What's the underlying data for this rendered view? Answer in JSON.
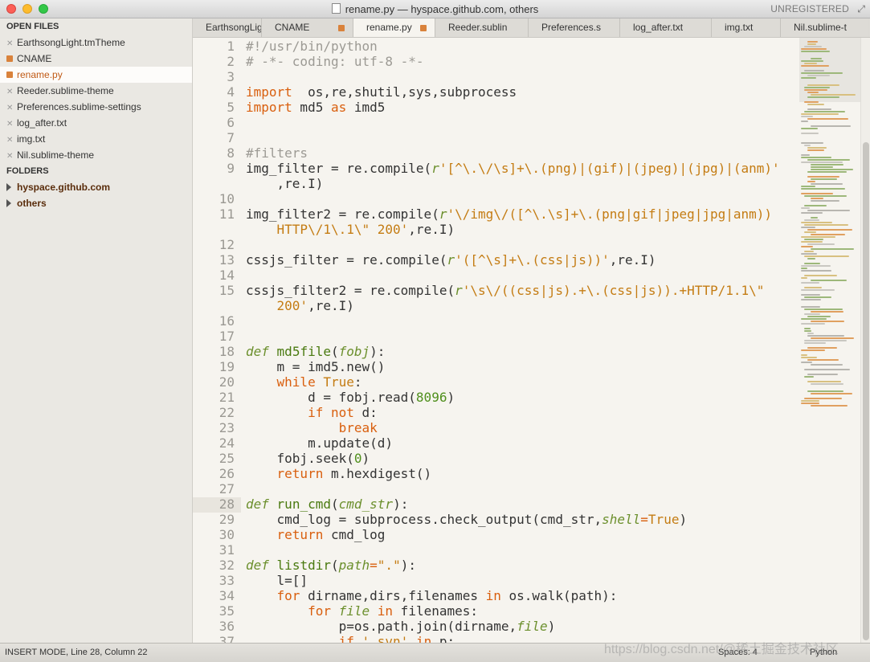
{
  "window": {
    "title": "rename.py — hyspace.github.com, others",
    "registration": "UNREGISTERED"
  },
  "sidebar": {
    "open_files_header": "OPEN FILES",
    "open_files": [
      {
        "label": "EarthsongLight.tmTheme",
        "modified": false,
        "active": false
      },
      {
        "label": "CNAME",
        "modified": true,
        "active": false
      },
      {
        "label": "rename.py",
        "modified": true,
        "active": true
      },
      {
        "label": "Reeder.sublime-theme",
        "modified": false,
        "active": false
      },
      {
        "label": "Preferences.sublime-settings",
        "modified": false,
        "active": false
      },
      {
        "label": "log_after.txt",
        "modified": false,
        "active": false
      },
      {
        "label": "img.txt",
        "modified": false,
        "active": false
      },
      {
        "label": "Nil.sublime-theme",
        "modified": false,
        "active": false
      }
    ],
    "folders_header": "FOLDERS",
    "folders": [
      {
        "label": "hyspace.github.com"
      },
      {
        "label": "others"
      }
    ]
  },
  "tabs": [
    {
      "label": "EarthsongLig",
      "modified": false,
      "active": false
    },
    {
      "label": "CNAME",
      "modified": true,
      "active": false
    },
    {
      "label": "rename.py",
      "modified": true,
      "active": true
    },
    {
      "label": "Reeder.sublin",
      "modified": false,
      "active": false
    },
    {
      "label": "Preferences.s",
      "modified": false,
      "active": false
    },
    {
      "label": "log_after.txt",
      "modified": false,
      "active": false
    },
    {
      "label": "img.txt",
      "modified": false,
      "active": false
    },
    {
      "label": "Nil.sublime-t",
      "modified": false,
      "active": false
    }
  ],
  "editor": {
    "current_line": 28,
    "lines": [
      {
        "n": "1",
        "segs": [
          [
            "cm",
            "#!/usr/bin/python"
          ]
        ]
      },
      {
        "n": "2",
        "segs": [
          [
            "cm",
            "# -*- coding: utf-8 -*-"
          ]
        ]
      },
      {
        "n": "3",
        "segs": []
      },
      {
        "n": "4",
        "segs": [
          [
            "kw",
            "import"
          ],
          [
            "",
            "  os,re,shutil,sys,subprocess"
          ]
        ]
      },
      {
        "n": "5",
        "segs": [
          [
            "kw",
            "import"
          ],
          [
            "",
            " md5 "
          ],
          [
            "kw",
            "as"
          ],
          [
            "",
            " imd5"
          ]
        ]
      },
      {
        "n": "6",
        "segs": []
      },
      {
        "n": "7",
        "segs": []
      },
      {
        "n": "8",
        "segs": [
          [
            "cm",
            "#filters"
          ]
        ]
      },
      {
        "n": "9",
        "segs": [
          [
            "",
            "img_filter = re.compile("
          ],
          [
            "it",
            "r"
          ],
          [
            "st",
            "'[^\\.\\/\\s]+\\.(png)|(gif)|(jpeg)|(jpg)|(anm)'"
          ]
        ]
      },
      {
        "n": "",
        "segs": [
          [
            "",
            "    ,re.I)"
          ]
        ]
      },
      {
        "n": "10",
        "segs": []
      },
      {
        "n": "11",
        "segs": [
          [
            "",
            "img_filter2 = re.compile("
          ],
          [
            "it",
            "r"
          ],
          [
            "st",
            "'\\/img\\/([^\\.\\s]+\\.(png|gif|jpeg|jpg|anm))"
          ]
        ]
      },
      {
        "n": "",
        "segs": [
          [
            "st",
            "    HTTP\\/1\\.1\\\" 200'"
          ],
          [
            "",
            ",re.I)"
          ]
        ]
      },
      {
        "n": "12",
        "segs": []
      },
      {
        "n": "13",
        "segs": [
          [
            "",
            "cssjs_filter = re.compile("
          ],
          [
            "it",
            "r"
          ],
          [
            "st",
            "'([^\\s]+\\.(css|js))'"
          ],
          [
            "",
            ",re.I)"
          ]
        ]
      },
      {
        "n": "14",
        "segs": []
      },
      {
        "n": "15",
        "segs": [
          [
            "",
            "cssjs_filter2 = re.compile("
          ],
          [
            "it",
            "r"
          ],
          [
            "st",
            "'\\s\\/((css|js).+\\.(css|js)).+HTTP/1.1\\\""
          ]
        ]
      },
      {
        "n": "",
        "segs": [
          [
            "st",
            "    200'"
          ],
          [
            "",
            ",re.I)"
          ]
        ]
      },
      {
        "n": "16",
        "segs": []
      },
      {
        "n": "17",
        "segs": []
      },
      {
        "n": "18",
        "segs": [
          [
            "it",
            "def"
          ],
          [
            "",
            " "
          ],
          [
            "fn",
            "md5file"
          ],
          [
            "",
            "("
          ],
          [
            "it",
            "fobj"
          ],
          [
            "",
            "):"
          ]
        ]
      },
      {
        "n": "19",
        "segs": [
          [
            "",
            "    m = imd5.new()"
          ]
        ]
      },
      {
        "n": "20",
        "segs": [
          [
            "",
            "    "
          ],
          [
            "kw",
            "while"
          ],
          [
            "",
            " "
          ],
          [
            "st",
            "True"
          ],
          [
            "",
            ":"
          ]
        ]
      },
      {
        "n": "21",
        "segs": [
          [
            "",
            "        d = fobj.read("
          ],
          [
            "nm",
            "8096"
          ],
          [
            "",
            ")"
          ]
        ]
      },
      {
        "n": "22",
        "segs": [
          [
            "",
            "        "
          ],
          [
            "kw",
            "if not"
          ],
          [
            "",
            " d:"
          ]
        ]
      },
      {
        "n": "23",
        "segs": [
          [
            "",
            "            "
          ],
          [
            "kw",
            "break"
          ]
        ]
      },
      {
        "n": "24",
        "segs": [
          [
            "",
            "        m.update(d)"
          ]
        ]
      },
      {
        "n": "25",
        "segs": [
          [
            "",
            "    fobj.seek("
          ],
          [
            "nm",
            "0"
          ],
          [
            "",
            ")"
          ]
        ]
      },
      {
        "n": "26",
        "segs": [
          [
            "",
            "    "
          ],
          [
            "kw",
            "return"
          ],
          [
            "",
            " m.hexdigest()"
          ]
        ]
      },
      {
        "n": "27",
        "segs": []
      },
      {
        "n": "28",
        "segs": [
          [
            "it",
            "def"
          ],
          [
            "",
            " "
          ],
          [
            "fn",
            "run_cmd"
          ],
          [
            "",
            "("
          ],
          [
            "it",
            "cmd_str"
          ],
          [
            "",
            "):"
          ]
        ]
      },
      {
        "n": "29",
        "segs": [
          [
            "",
            "    cmd_log = subprocess.check_output(cmd_str,"
          ],
          [
            "it",
            "shell"
          ],
          [
            "kw",
            "="
          ],
          [
            "st",
            "True"
          ],
          [
            "",
            ")"
          ]
        ]
      },
      {
        "n": "30",
        "segs": [
          [
            "",
            "    "
          ],
          [
            "kw",
            "return"
          ],
          [
            "",
            " cmd_log"
          ]
        ]
      },
      {
        "n": "31",
        "segs": []
      },
      {
        "n": "32",
        "segs": [
          [
            "it",
            "def"
          ],
          [
            "",
            " "
          ],
          [
            "fn",
            "listdir"
          ],
          [
            "",
            "("
          ],
          [
            "it",
            "path"
          ],
          [
            "kw",
            "="
          ],
          [
            "st",
            "\".\""
          ],
          [
            "",
            "):"
          ]
        ]
      },
      {
        "n": "33",
        "segs": [
          [
            "",
            "    l=[]"
          ]
        ]
      },
      {
        "n": "34",
        "segs": [
          [
            "",
            "    "
          ],
          [
            "kw",
            "for"
          ],
          [
            "",
            " dirname,dirs,filenames "
          ],
          [
            "kw",
            "in"
          ],
          [
            "",
            " os.walk(path):"
          ]
        ]
      },
      {
        "n": "35",
        "segs": [
          [
            "",
            "        "
          ],
          [
            "kw",
            "for"
          ],
          [
            "",
            " "
          ],
          [
            "it",
            "file"
          ],
          [
            "",
            " "
          ],
          [
            "kw",
            "in"
          ],
          [
            "",
            " filenames:"
          ]
        ]
      },
      {
        "n": "36",
        "segs": [
          [
            "",
            "            p=os.path.join(dirname,"
          ],
          [
            "it",
            "file"
          ],
          [
            "",
            ")"
          ]
        ]
      },
      {
        "n": "37",
        "segs": [
          [
            "",
            "            "
          ],
          [
            "kw",
            "if"
          ],
          [
            "",
            " "
          ],
          [
            "st",
            "'.svn'"
          ],
          [
            "",
            " "
          ],
          [
            "kw",
            "in"
          ],
          [
            "",
            " p:"
          ]
        ]
      }
    ]
  },
  "statusbar": {
    "mode": "INSERT MODE, Line 28, Column 22",
    "spaces": "Spaces: 4",
    "syntax": "Python"
  },
  "watermark": "https://blog.csdn.net/@稀土掘金技术社区",
  "colors": {
    "keyword": "#d95f0e",
    "string": "#c47c13",
    "comment": "#9c9a94",
    "function": "#4a7a10",
    "modified_dot": "#d9823b"
  }
}
